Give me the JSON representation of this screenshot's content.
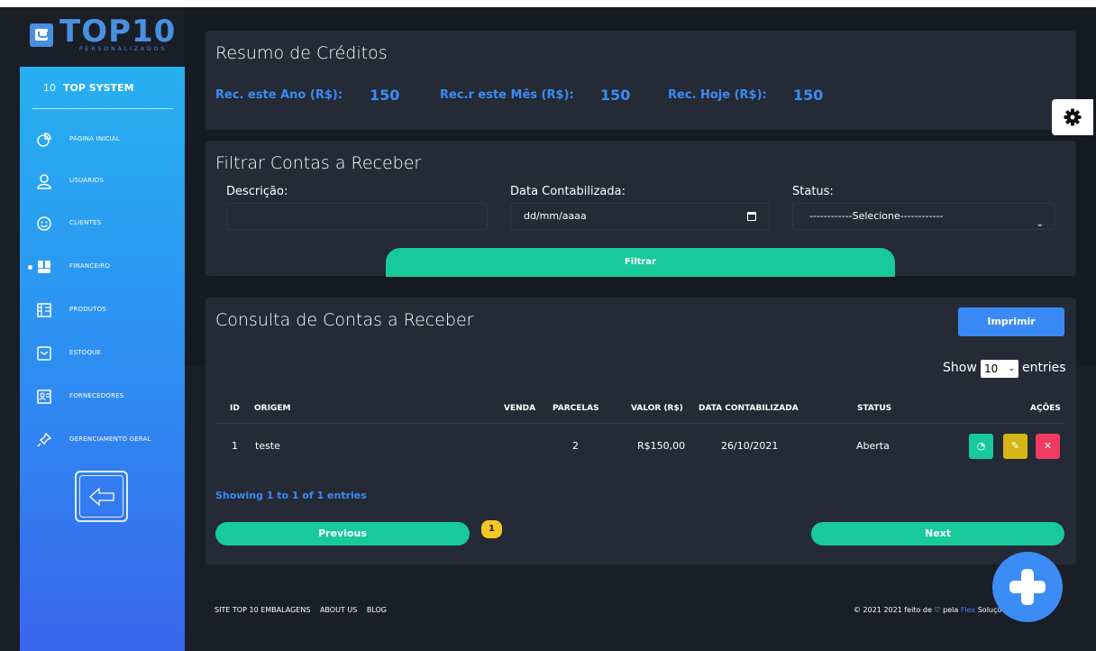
{
  "brand": {
    "logo_text": "TOP10",
    "logo_sub": "PERSONALIZADOS"
  },
  "sidebar": {
    "header_num": "10",
    "header_name": "TOP SYSTEM",
    "items": [
      {
        "label": "PÁGINA INICIAL",
        "icon": "pie-chart-icon",
        "active": false
      },
      {
        "label": "USUÁRIOS",
        "icon": "user-icon",
        "active": false
      },
      {
        "label": "CLIENTES",
        "icon": "smile-icon",
        "active": false
      },
      {
        "label": "FINANCEIRO",
        "icon": "people-icon",
        "active": true
      },
      {
        "label": "PRODUTOS",
        "icon": "box-grid-icon",
        "active": false
      },
      {
        "label": "ESTOQUE",
        "icon": "inbox-icon",
        "active": false
      },
      {
        "label": "FORNECEDORES",
        "icon": "supplier-icon",
        "active": false
      },
      {
        "label": "GERENCIAMENTO GERAL",
        "icon": "pin-icon",
        "active": false
      }
    ],
    "back_icon": "arrow-left-icon"
  },
  "summary": {
    "title": "Resumo de Créditos",
    "stats": [
      {
        "label": "Rec. este Ano (R$):",
        "value": "150"
      },
      {
        "label": "Rec.r este Mês (R$):",
        "value": "150"
      },
      {
        "label": "Rec. Hoje (R$):",
        "value": "150"
      }
    ]
  },
  "filter": {
    "title": "Filtrar Contas a Receber",
    "descricao_label": "Descrição:",
    "descricao_value": "",
    "data_label": "Data Contabilizada:",
    "data_placeholder": "dd/mm/aaaa",
    "status_label": "Status:",
    "status_selected": "------------Selecione------------",
    "button": "Filtrar"
  },
  "consulta": {
    "title": "Consulta de Contas a Receber",
    "print_button": "Imprimir",
    "show_label": "Show",
    "entries_value": "10",
    "entries_label": "entries",
    "columns": [
      "ID",
      "ORIGEM",
      "VENDA",
      "PARCELAS",
      "VALOR (R$)",
      "DATA CONTABILIZADA",
      "STATUS",
      "AÇÕES"
    ],
    "rows": [
      {
        "id": "1",
        "origem": "teste",
        "venda": "",
        "parcelas": "2",
        "valor": "R$150,00",
        "data": "26/10/2021",
        "status": "Aberta"
      }
    ],
    "actions": {
      "view": "◔",
      "edit": "✎",
      "delete": "✕"
    },
    "showing": "Showing 1 to 1 of 1 entries",
    "prev": "Previous",
    "page": "1",
    "next": "Next"
  },
  "footer": {
    "links": [
      "SITE TOP 10 EMBALAGENS",
      "ABOUT US",
      "BLOG"
    ],
    "copy_pre": "© 2021 2021 feito de ",
    "copy_heart": "♡",
    "copy_mid": " pela ",
    "copy_flex": "Flex",
    "copy_post": " Soluções em Te"
  },
  "colors": {
    "accent": "#3b8cf5",
    "green": "#17c99b",
    "card": "#252a37",
    "bg": "#1a1e27"
  }
}
